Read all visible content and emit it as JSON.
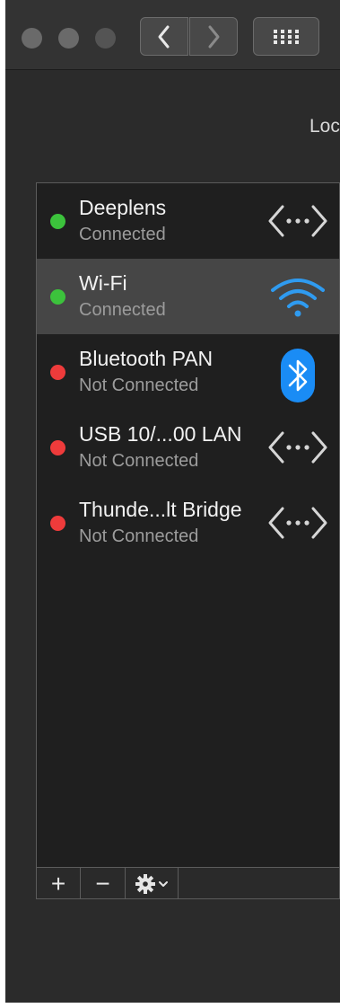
{
  "toolbar": {
    "back_icon": "chevron-left-icon",
    "forward_icon": "chevron-right-icon",
    "show_all_icon": "grid-icon"
  },
  "location": {
    "label": "Loc"
  },
  "services": [
    {
      "name": "Deeplens",
      "status": "Connected",
      "status_color": "#3cc23c",
      "icon": "ethernet-icon"
    },
    {
      "name": "Wi-Fi",
      "status": "Connected",
      "status_color": "#3cc23c",
      "icon": "wifi-icon",
      "selected": true
    },
    {
      "name": "Bluetooth PAN",
      "status": "Not Connected",
      "status_color": "#ee3b3b",
      "icon": "bluetooth-icon"
    },
    {
      "name": "USB 10/...00 LAN",
      "status": "Not Connected",
      "status_color": "#ee3b3b",
      "icon": "ethernet-icon"
    },
    {
      "name": "Thunde...lt Bridge",
      "status": "Not Connected",
      "status_color": "#ee3b3b",
      "icon": "ethernet-icon"
    }
  ],
  "list_controls": {
    "add_label": "+",
    "remove_label": "−",
    "action_icon": "gear-icon",
    "action_menu_icon": "chevron-down-icon"
  },
  "colors": {
    "wifi_blue": "#2f9bf0",
    "bluetooth_blue": "#1a8cf5"
  }
}
